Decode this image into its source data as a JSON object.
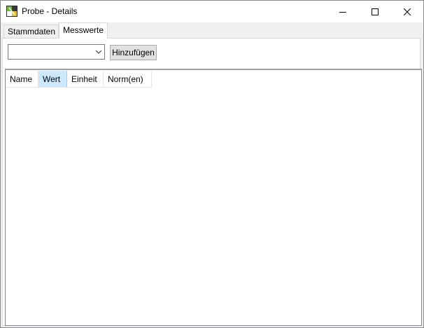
{
  "window": {
    "title": "Probe - Details",
    "icon": "app-icon"
  },
  "tabs": [
    {
      "label": "Stammdaten",
      "selected": false
    },
    {
      "label": "Messwerte",
      "selected": true
    }
  ],
  "toolbar": {
    "combo_value": "",
    "add_label": "Hinzufügen"
  },
  "listview": {
    "columns": [
      "Name",
      "Wert",
      "Einheit",
      "Norm(en)"
    ],
    "sorted_column": "Wert",
    "rows": []
  },
  "colors": {
    "selected_header": "#cce8ff",
    "title_bg": "#ffffff"
  }
}
